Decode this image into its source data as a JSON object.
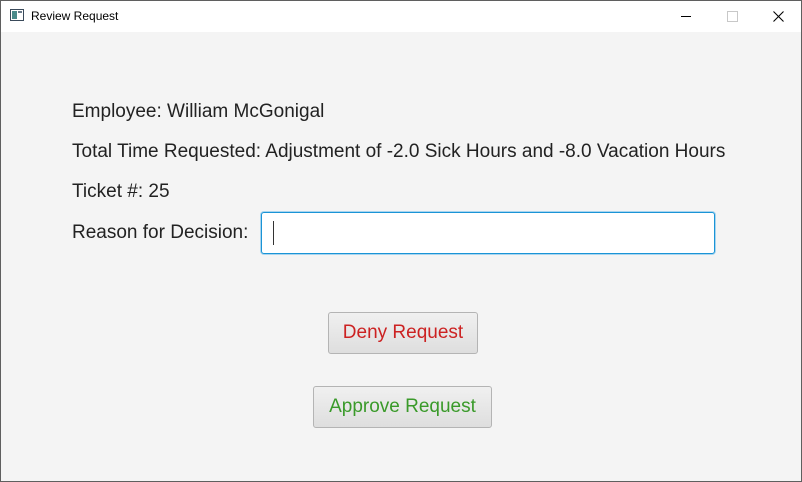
{
  "window": {
    "title": "Review Request"
  },
  "form": {
    "employee_label": "Employee: William McGonigal",
    "time_label": "Total Time Requested: Adjustment of -2.0 Sick Hours and -8.0 Vacation Hours",
    "ticket_label": "Ticket #: 25",
    "reason_label": "Reason for Decision:",
    "reason_value": ""
  },
  "actions": {
    "deny_label": "Deny Request",
    "approve_label": "Approve Request"
  },
  "colors": {
    "deny_text": "#cc2222",
    "approve_text": "#3a9a2a",
    "focus_border": "#1a94d6"
  }
}
